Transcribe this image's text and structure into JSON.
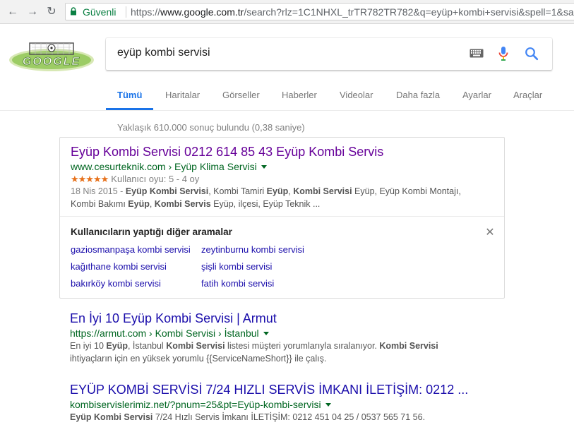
{
  "browser": {
    "secure_label": "Güvenli",
    "url_scheme": "https://",
    "url_host": "www.google.com.tr",
    "url_rest": "/search?rlz=1C1NHXL_trTR782TR782&q=eyüp+kombi+servisi&spell=1&sa"
  },
  "search": {
    "query": "eyüp kombi servisi"
  },
  "tabs": [
    "Tümü",
    "Haritalar",
    "Görseller",
    "Haberler",
    "Videolar",
    "Daha fazla",
    "Ayarlar",
    "Araçlar"
  ],
  "stats": "Yaklaşık 610.000 sonuç bulundu (0,38 saniye)",
  "results": [
    {
      "title": "Eyüp Kombi Servisi 0212 614 85 43 Eyüp Kombi Servis",
      "url": "www.cesurteknik.com › Eyüp Klima Servisi",
      "stars": "★★★★★",
      "rating": "Kullanıcı oyu: 5 - 4 oy",
      "date": "18 Nis 2015 - ",
      "snippet_parts": [
        "Eyüp Kombi Servisi",
        ", Kombi Tamiri ",
        "Eyüp",
        ", ",
        "Kombi Servisi",
        " Eyüp, Eyüp Kombi Montajı,",
        "Kombi Bakımı ",
        "Eyüp",
        ", ",
        "Kombi Servis",
        " Eyüp, ilçesi, Eyüp Teknik ..."
      ]
    },
    {
      "title": "En İyi 10 Eyüp Kombi Servisi | Armut",
      "url": "https://armut.com › Kombi Servisi › İstanbul",
      "snippet_parts": [
        "En iyi 10 ",
        "Eyüp",
        ", İstanbul ",
        "Kombi Servisi",
        " listesi müşteri yorumlarıyla sıralanıyor. ",
        "Kombi Servisi",
        "ihtiyaçların için en yüksek yorumlu {{ServiceNameShort}} ile çalış."
      ]
    },
    {
      "title": "EYÜP KOMBİ SERVİSİ 7/24 HIZLI SERVİS İMKANI İLETİŞİM: 0212 ...",
      "url": "kombiservislerimiz.net/?pnum=25&pt=Eyüp-kombi-servisi",
      "snippet_parts": [
        "Eyüp Kombi Servisi",
        " 7/24 Hızlı Servis İmkanı İLETİŞİM: 0212 451 04 25 / 0537 565 71 56."
      ]
    }
  ],
  "related": {
    "title": "Kullanıcıların yaptığı diğer aramalar",
    "items": [
      "gaziosmanpaşa kombi servisi",
      "zeytinburnu kombi servisi",
      "kağıthane kombi servisi",
      "şişli kombi servisi",
      "bakırköy kombi servisi",
      "fatih kombi servisi"
    ]
  },
  "colors": {
    "link": "#1a0dab",
    "visited": "#660099",
    "url_green": "#006621",
    "active_tab": "#1a73e8",
    "star": "#e7711b"
  }
}
